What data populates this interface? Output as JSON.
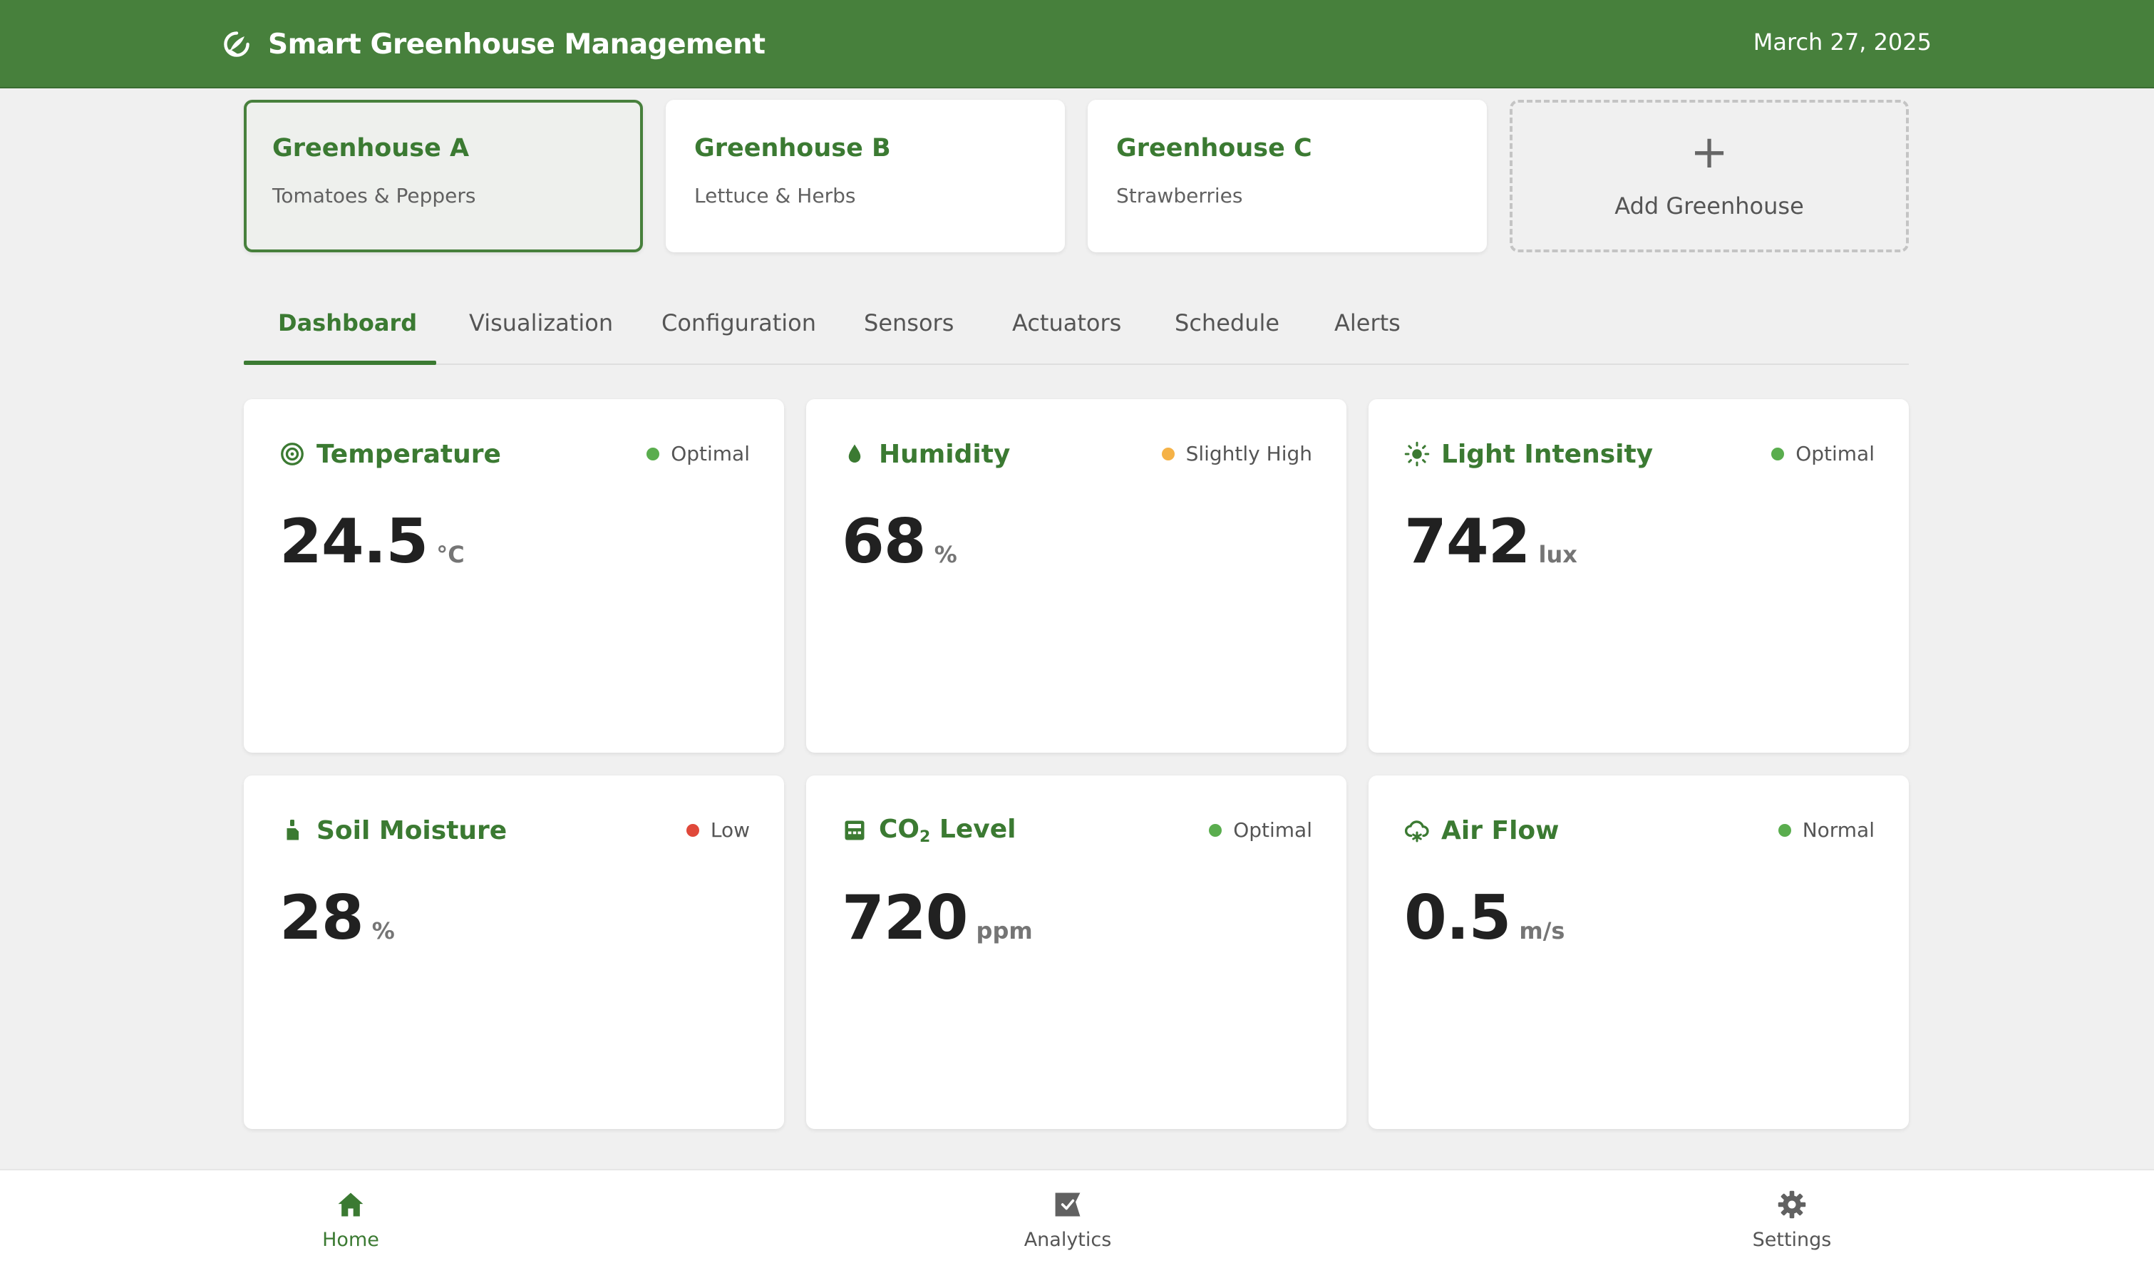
{
  "header": {
    "title": "Smart Greenhouse Management",
    "date": "March 27, 2025",
    "logo_icon": "greenhouse-leaf-icon"
  },
  "greenhouses": [
    {
      "name": "Greenhouse A",
      "crop": "Tomatoes & Peppers",
      "active": true
    },
    {
      "name": "Greenhouse B",
      "crop": "Lettuce & Herbs",
      "active": false
    },
    {
      "name": "Greenhouse C",
      "crop": "Strawberries",
      "active": false
    }
  ],
  "add_greenhouse": {
    "symbol": "+",
    "label": "Add Greenhouse"
  },
  "tabs": [
    {
      "label": "Dashboard",
      "active": true
    },
    {
      "label": "Visualization"
    },
    {
      "label": "Configuration"
    },
    {
      "label": "Sensors"
    },
    {
      "label": "Actuators"
    },
    {
      "label": "Schedule"
    },
    {
      "label": "Alerts"
    }
  ],
  "metrics": {
    "temperature": {
      "title": "Temperature",
      "status": "Optimal",
      "value": "24.5",
      "unit": "°C",
      "icon": "target-icon",
      "status_color": "#5aad4e"
    },
    "humidity": {
      "title": "Humidity",
      "status": "Slightly High",
      "value": "68",
      "unit": "%",
      "icon": "water-drop-icon",
      "status_color": "#f5b247"
    },
    "light": {
      "title": "Light Intensity",
      "status": "Optimal",
      "value": "742",
      "unit": "lux",
      "icon": "sun-icon",
      "status_color": "#5aad4e"
    },
    "soil": {
      "title": "Soil Moisture",
      "status": "Low",
      "value": "28",
      "unit": "%",
      "icon": "soil-sensor-icon",
      "status_color": "#e0483a"
    },
    "co2": {
      "title_main": "CO",
      "title_sub": "2",
      "title_rest": " Level",
      "status": "Optimal",
      "value": "720",
      "unit": "ppm",
      "icon": "co2-meter-icon",
      "status_color": "#5aad4e"
    },
    "airflow": {
      "title": "Air Flow",
      "status": "Normal",
      "value": "0.5",
      "unit": "m/s",
      "icon": "wind-icon",
      "status_color": "#5aad4e"
    }
  },
  "bottom_nav": [
    {
      "label": "Home",
      "icon": "home-icon",
      "active": true
    },
    {
      "label": "Analytics",
      "icon": "analytics-icon"
    },
    {
      "label": "Settings",
      "icon": "gear-icon"
    }
  ],
  "colors": {
    "brand_green": "#47803c",
    "accent_green": "#3b7a32",
    "background": "#f0f0f0",
    "ok": "#5aad4e",
    "warning": "#f5b247",
    "danger": "#e0483a"
  }
}
